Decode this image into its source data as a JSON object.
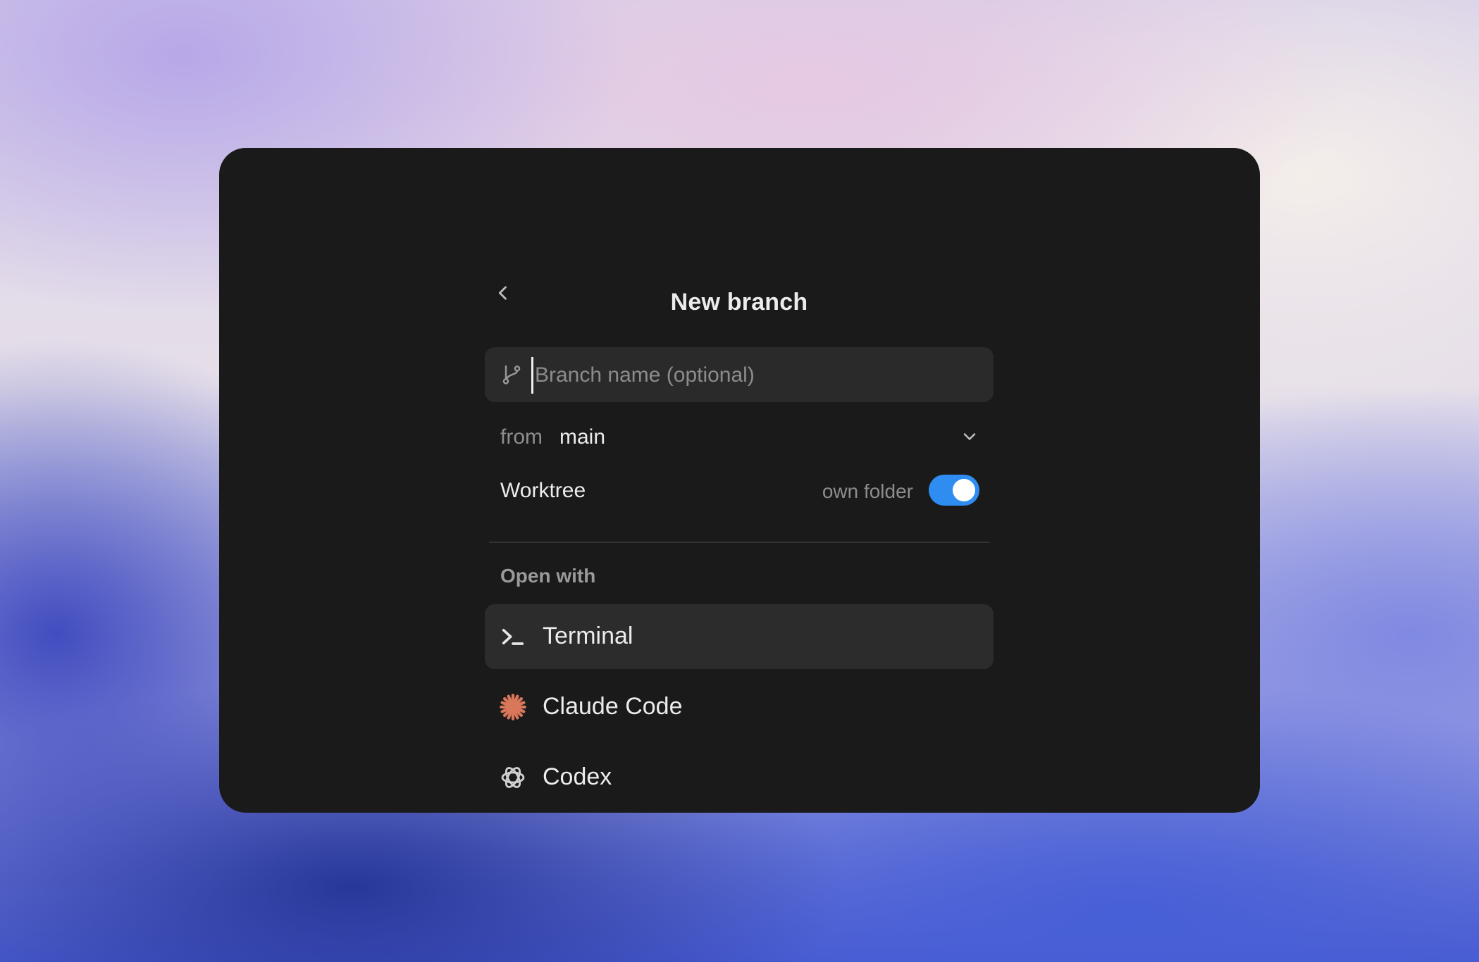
{
  "dialog": {
    "title": "New branch",
    "back_icon": "chevron-left-icon"
  },
  "branch_input": {
    "placeholder": "Branch name (optional)",
    "value": "",
    "icon": "git-branch-icon"
  },
  "from_row": {
    "label": "from",
    "value": "main",
    "icon": "chevron-down-icon"
  },
  "worktree_row": {
    "label": "Worktree",
    "toggle_label": "own folder",
    "toggle_on": true
  },
  "open_with": {
    "label": "Open with",
    "items": [
      {
        "label": "Terminal",
        "icon": "terminal-icon",
        "selected": true
      },
      {
        "label": "Claude Code",
        "icon": "claude-icon",
        "selected": false
      },
      {
        "label": "Codex",
        "icon": "openai-icon",
        "selected": false
      }
    ]
  },
  "colors": {
    "window_bg": "#1a1a1a",
    "input_bg": "#2a2a2a",
    "toggle_accent": "#2f8cf0",
    "claude_icon": "#d9775a",
    "selected_item_bg": "#2c2c2c"
  }
}
